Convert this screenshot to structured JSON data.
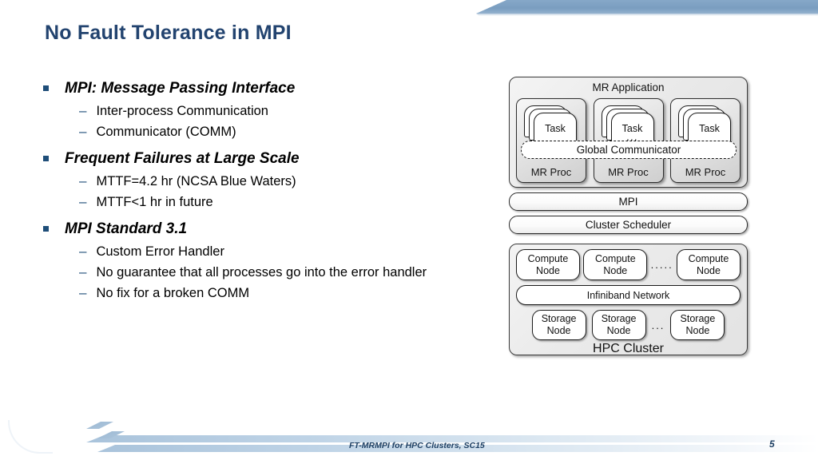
{
  "slide": {
    "title": "No Fault Tolerance in MPI",
    "number": "5",
    "footer": "FT-MRMPI for HPC Clusters, SC15"
  },
  "colors": {
    "title": "#22436f",
    "bullet_marker": "#1f4e79",
    "banner": "#7ba0c4",
    "stripe": "#a9c3db",
    "footer_text": "#1d3f63"
  },
  "bullets": [
    {
      "heading": "MPI: Message Passing Interface",
      "sub": [
        "Inter-process Communication",
        "Communicator (COMM)"
      ]
    },
    {
      "heading": "Frequent Failures at Large Scale",
      "sub": [
        "MTTF=4.2 hr (NCSA Blue Waters)",
        "MTTF<1 hr in future"
      ]
    },
    {
      "heading": "MPI Standard 3.1",
      "sub": [
        "Custom Error Handler",
        "No guarantee that all processes go into the error handler",
        "No fix for a broken COMM"
      ]
    }
  ],
  "diagram": {
    "application": {
      "title": "MR Application",
      "ellipsis": "...",
      "global_communicator": "Global Communicator",
      "procs": [
        {
          "label": "MR Proc",
          "task_label": "Task"
        },
        {
          "label": "MR Proc",
          "task_label": "Task"
        },
        {
          "label": "MR Proc",
          "task_label": "Task"
        }
      ]
    },
    "layers": [
      "MPI",
      "Cluster Scheduler"
    ],
    "cluster": {
      "title": "HPC Cluster",
      "compute_nodes": [
        {
          "line1": "Compute",
          "line2": "Node"
        },
        {
          "line1": "Compute",
          "line2": "Node"
        },
        {
          "line1": "Compute",
          "line2": "Node"
        }
      ],
      "compute_ellipsis": ".....",
      "network": "Infiniband Network",
      "storage_nodes": [
        {
          "line1": "Storage",
          "line2": "Node"
        },
        {
          "line1": "Storage",
          "line2": "Node"
        },
        {
          "line1": "Storage",
          "line2": "Node"
        }
      ],
      "storage_ellipsis": "..."
    }
  }
}
